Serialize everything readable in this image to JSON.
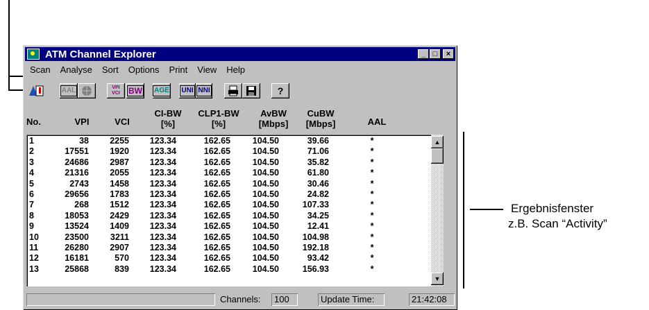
{
  "window": {
    "title": "ATM Channel Explorer",
    "controls": [
      "_",
      "□",
      "×"
    ]
  },
  "menu": [
    "Scan",
    "Analyse",
    "Sort",
    "Options",
    "Print",
    "View",
    "Help"
  ],
  "toolbar": {
    "buttons": [
      {
        "name": "scan-run-icon",
        "label": ""
      },
      {
        "name": "aal-button",
        "label": "AAL"
      },
      {
        "name": "globe-button",
        "label": ""
      },
      {
        "name": "vpi-vci-button",
        "label": "VPI VCI"
      },
      {
        "name": "bw-button",
        "label": "BW"
      },
      {
        "name": "age-button",
        "label": "AGE"
      },
      {
        "name": "uni-button",
        "label": "UNI"
      },
      {
        "name": "nni-button",
        "label": "NNI"
      },
      {
        "name": "print-button",
        "label": ""
      },
      {
        "name": "save-button",
        "label": ""
      },
      {
        "name": "help-button",
        "label": "?"
      }
    ]
  },
  "columns": [
    {
      "line1": "No.",
      "line2": ""
    },
    {
      "line1": "VPI",
      "line2": ""
    },
    {
      "line1": "VCI",
      "line2": ""
    },
    {
      "line1": "CI-BW",
      "line2": "[%]"
    },
    {
      "line1": "CLP1-BW",
      "line2": "[%]"
    },
    {
      "line1": "AvBW",
      "line2": "[Mbps]"
    },
    {
      "line1": "CuBW",
      "line2": "[Mbps]"
    },
    {
      "line1": "AAL",
      "line2": ""
    }
  ],
  "rows": [
    [
      "1",
      "38",
      "2255",
      "123.34",
      "162.65",
      "104.50",
      "39.66",
      "*"
    ],
    [
      "2",
      "17551",
      "1920",
      "123.34",
      "162.65",
      "104.50",
      "71.06",
      "*"
    ],
    [
      "3",
      "24686",
      "2987",
      "123.34",
      "162.65",
      "104.50",
      "35.82",
      "*"
    ],
    [
      "4",
      "21316",
      "2055",
      "123.34",
      "162.65",
      "104.50",
      "61.80",
      "*"
    ],
    [
      "5",
      "2743",
      "1458",
      "123.34",
      "162.65",
      "104.50",
      "30.46",
      "*"
    ],
    [
      "6",
      "29656",
      "1783",
      "123.34",
      "162.65",
      "104.50",
      "24.82",
      "*"
    ],
    [
      "7",
      "268",
      "1512",
      "123.34",
      "162.65",
      "104.50",
      "107.33",
      "*"
    ],
    [
      "8",
      "18053",
      "2429",
      "123.34",
      "162.65",
      "104.50",
      "34.25",
      "*"
    ],
    [
      "9",
      "13524",
      "1409",
      "123.34",
      "162.65",
      "104.50",
      "12.41",
      "*"
    ],
    [
      "10",
      "23500",
      "3211",
      "123.34",
      "162.65",
      "104.50",
      "104.98",
      "*"
    ],
    [
      "11",
      "26280",
      "2907",
      "123.34",
      "162.65",
      "104.50",
      "192.18",
      "*"
    ],
    [
      "12",
      "16181",
      "570",
      "123.34",
      "162.65",
      "104.50",
      "93.42",
      "*"
    ],
    [
      "13",
      "25868",
      "839",
      "123.34",
      "162.65",
      "104.50",
      "156.93",
      "*"
    ]
  ],
  "status": {
    "channels_label": "Channels:",
    "channels_value": "100",
    "update_label": "Update Time:",
    "update_value": "21:42:08"
  },
  "annotation": {
    "line1": "Ergebnisfenster",
    "line2": "z.B. Scan “Activity”"
  }
}
